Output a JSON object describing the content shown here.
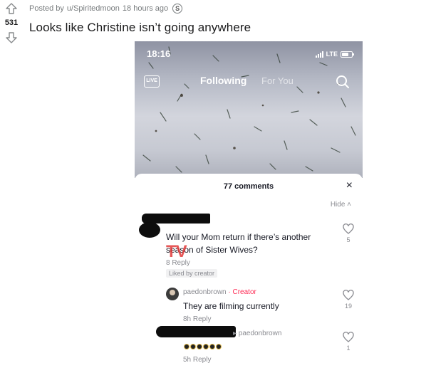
{
  "post": {
    "score": "531",
    "meta_prefix": "Posted by",
    "username": "u/Spiritedmoon",
    "time_ago": "18 hours ago",
    "title": "Looks like Christine isn’t going anywhere"
  },
  "phone": {
    "status_time": "18:16",
    "carrier": "LTE",
    "nav": {
      "live": "LIVE",
      "following": "Following",
      "for_you": "For You"
    }
  },
  "sheet": {
    "title": "77 comments",
    "close": "×",
    "hide": "Hide ˄",
    "watermark": "TV",
    "comments": [
      {
        "text_line1": "Will your Mom return if there’s another",
        "text_line2": "season of Sister Wives?",
        "meta": "8  Reply",
        "badge": "Liked by creator",
        "likes": "5"
      },
      {
        "username": "paedonbrown",
        "creator": "· Creator",
        "text": "They are filming currently",
        "meta": "8h  Reply",
        "likes": "19"
      },
      {
        "reply_to": "▸ paedonbrown",
        "meta": "5h  Reply",
        "likes": "1"
      }
    ]
  },
  "icons": [
    "upvote-icon",
    "downvote-icon",
    "award-icon",
    "live-icon",
    "search-icon",
    "heart-icon",
    "close-icon"
  ],
  "colors": {
    "creator": "#fe2c55",
    "meta": "#787c7e",
    "title": "#1a1a1b"
  }
}
